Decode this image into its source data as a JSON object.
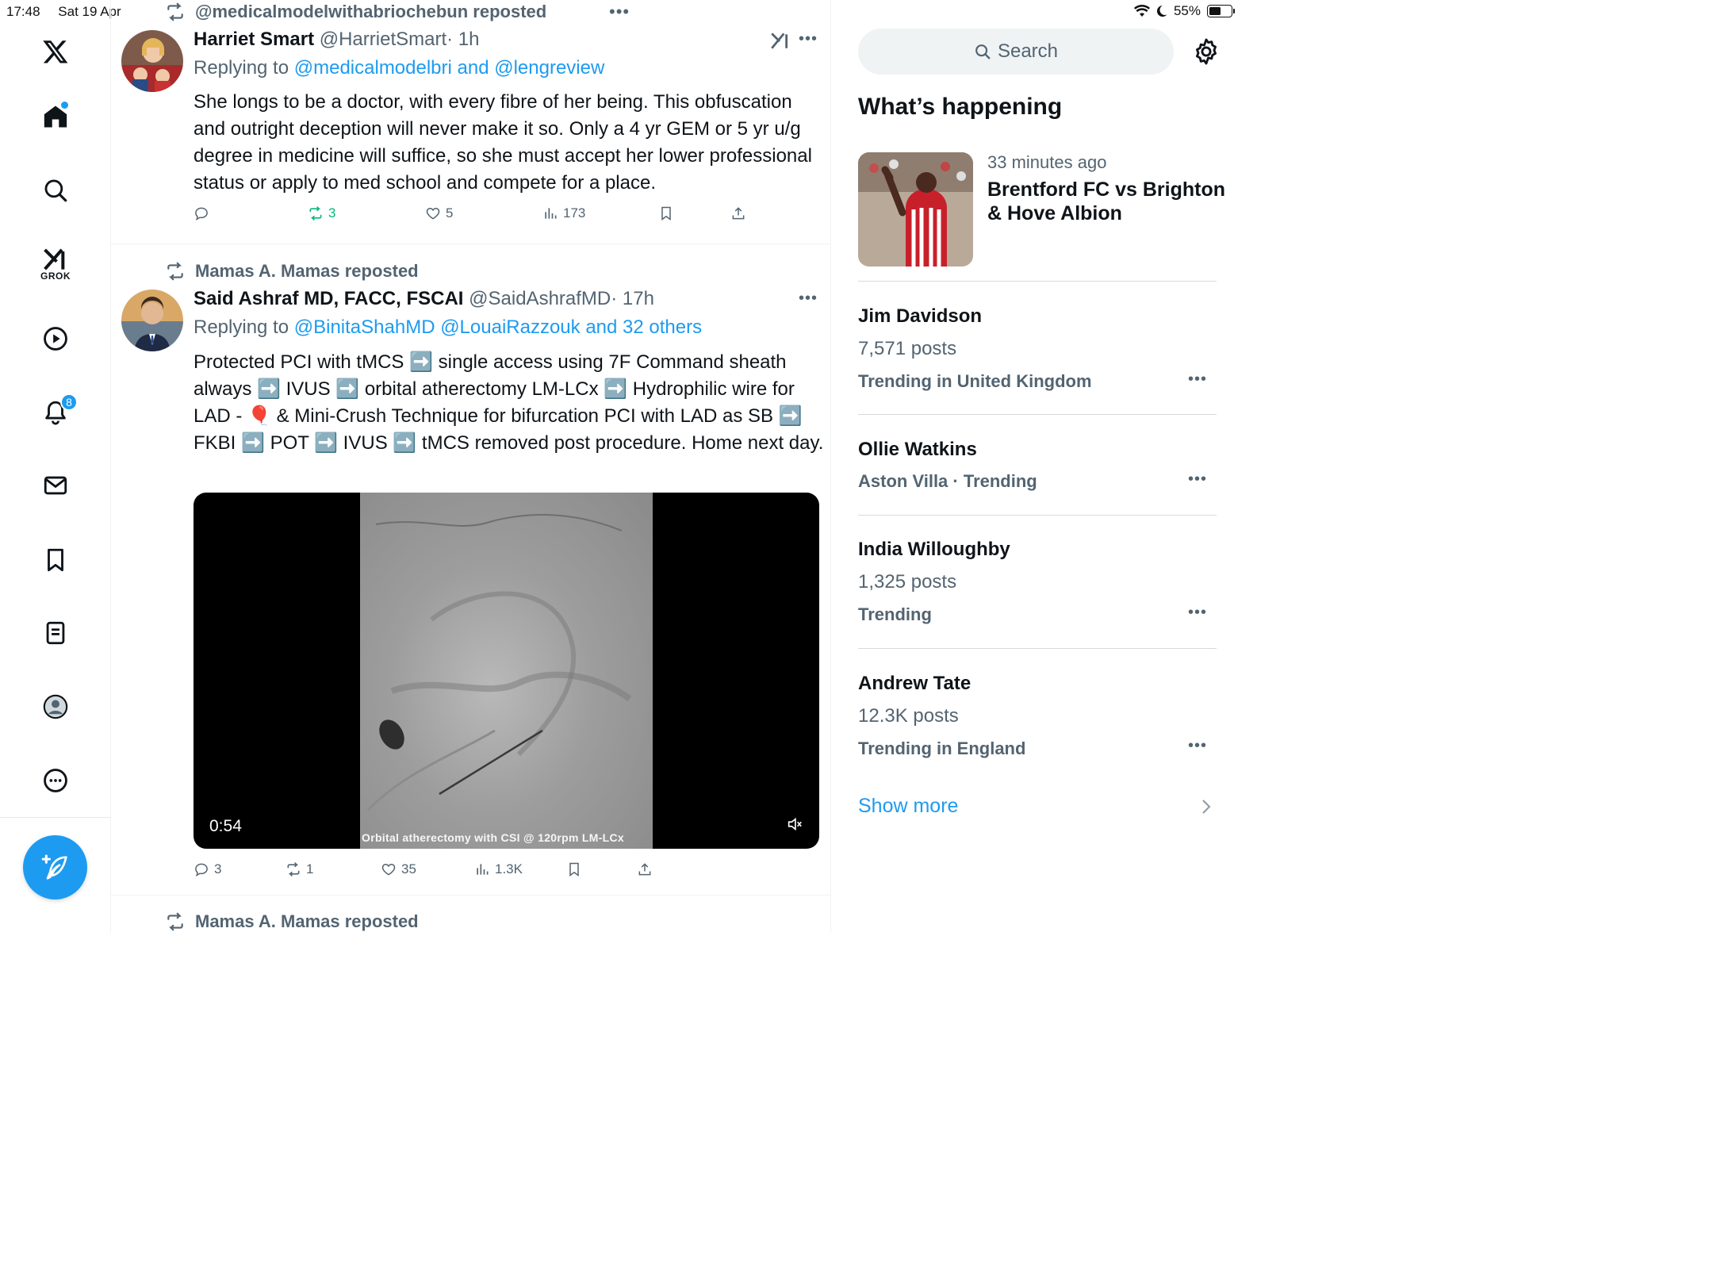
{
  "status": {
    "time": "17:48",
    "date": "Sat 19 Apr",
    "battery": "55%",
    "battery_level": 0.55
  },
  "nav": {
    "items": [
      "x-logo",
      "home",
      "explore",
      "grok",
      "video",
      "notifications",
      "messages",
      "bookmarks",
      "lists",
      "profile",
      "more"
    ],
    "grok_label": "GROK",
    "notification_count": "8"
  },
  "feed": {
    "tweets": [
      {
        "repost_label": "@medicalmodelwithabriochebun reposted",
        "name": "Harriet Smart",
        "handle": "@HarrietSmart",
        "time": "· 1h",
        "reply_prefix": "Replying to",
        "reply_targets": "@medicalmodelbri and @lengreview",
        "text": "She longs to be a doctor, with every fibre of her being. This obfuscation and outright deception will never make it so. Only a 4 yr GEM or 5 yr u/g degree in medicine will suffice, so she must accept her lower professional status or apply to med school and compete for a place.",
        "replies": "",
        "reposts": "3",
        "likes": "5",
        "views": "173"
      },
      {
        "repost_label": "Mamas A. Mamas reposted",
        "name": "Said Ashraf MD, FACC, FSCAI",
        "handle": "@SaidAshrafMD",
        "time": "· 17h",
        "reply_prefix": "Replying to",
        "reply_targets": "@BinitaShahMD @LouaiRazzouk and 32 others",
        "text": "Protected PCI with tMCS ➡️ single access using 7F Command sheath always ➡️ IVUS ➡️ orbital atherectomy LM-LCx ➡️ Hydrophilic wire for LAD  - 🎈 & Mini-Crush Technique for bifurcation PCI with LAD as SB ➡️ FKBI ➡️ POT ➡️ IVUS ➡️ tMCS removed post procedure. Home next day.",
        "video_duration": "0:54",
        "video_caption": "Orbital atherectomy with CSI @ 120rpm LM-LCx",
        "replies": "3",
        "reposts": "1",
        "likes": "35",
        "views": "1.3K"
      },
      {
        "repost_label": "Mamas A. Mamas reposted"
      }
    ]
  },
  "sidebar": {
    "search_placeholder": "Search",
    "whats_happening": "What’s happening",
    "feature": {
      "time": "33 minutes ago",
      "title": "Brentford FC vs Brighton & Hove Albion"
    },
    "trends": [
      {
        "name": "Jim Davidson",
        "posts": "7,571 posts",
        "context": "Trending in United Kingdom"
      },
      {
        "name": "Ollie Watkins",
        "posts": "",
        "context": "Aston Villa · Trending"
      },
      {
        "name": "India Willoughby",
        "posts": "1,325 posts",
        "context": "Trending"
      },
      {
        "name": "Andrew Tate",
        "posts": "12.3K posts",
        "context": "Trending in England"
      }
    ],
    "show_more": "Show more"
  },
  "colors": {
    "accent": "#1d9bf0",
    "repost_green": "#00ba7c",
    "secondary_text": "#536471"
  }
}
